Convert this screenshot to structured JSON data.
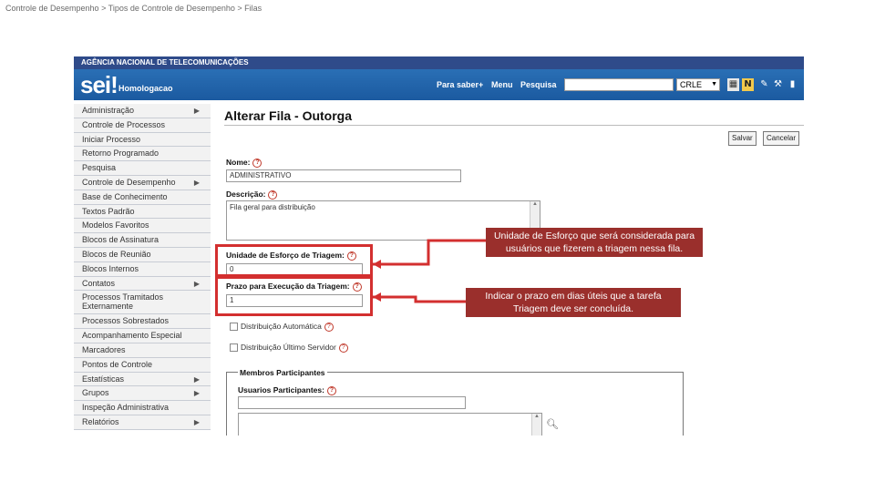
{
  "breadcrumb": "Controle de Desempenho > Tipos de Controle de Desempenho > Filas",
  "agency": "AGÊNCIA NACIONAL DE TELECOMUNICAÇÕES",
  "header": {
    "logo": "sei!",
    "environment": "Homologacao",
    "nav": [
      "Para saber+",
      "Menu",
      "Pesquisa"
    ],
    "search_value": "",
    "unit": "CRLE",
    "icons": [
      "notification-icon",
      "user-icon",
      "tools-icon",
      "exit-icon"
    ]
  },
  "sidebar": {
    "items": [
      {
        "label": "Administração",
        "submenu": true
      },
      {
        "label": "Controle de Processos",
        "submenu": false
      },
      {
        "label": "Iniciar Processo",
        "submenu": false
      },
      {
        "label": "Retorno Programado",
        "submenu": false
      },
      {
        "label": "Pesquisa",
        "submenu": false
      },
      {
        "label": "Controle de Desempenho",
        "submenu": true
      },
      {
        "label": "Base de Conhecimento",
        "submenu": false
      },
      {
        "label": "Textos Padrão",
        "submenu": false
      },
      {
        "label": "Modelos Favoritos",
        "submenu": false
      },
      {
        "label": "Blocos de Assinatura",
        "submenu": false
      },
      {
        "label": "Blocos de Reunião",
        "submenu": false
      },
      {
        "label": "Blocos Internos",
        "submenu": false
      },
      {
        "label": "Contatos",
        "submenu": true
      },
      {
        "label": "Processos Tramitados Externamente",
        "submenu": false,
        "tall": true
      },
      {
        "label": "Processos Sobrestados",
        "submenu": false
      },
      {
        "label": "Acompanhamento Especial",
        "submenu": false
      },
      {
        "label": "Marcadores",
        "submenu": false
      },
      {
        "label": "Pontos de Controle",
        "submenu": false
      },
      {
        "label": "Estatísticas",
        "submenu": true
      },
      {
        "label": "Grupos",
        "submenu": true
      },
      {
        "label": "Inspeção Administrativa",
        "submenu": false
      },
      {
        "label": "Relatórios",
        "submenu": true
      }
    ]
  },
  "form": {
    "title": "Alterar Fila - Outorga",
    "save_label": "Salvar",
    "cancel_label": "Cancelar",
    "nome_label": "Nome:",
    "nome_value": "ADMINISTRATIVO",
    "descricao_label": "Descrição:",
    "descricao_value": "Fila geral para distribuição",
    "esforco_label": "Unidade de Esforço de Triagem:",
    "esforco_value": "0",
    "prazo_label": "Prazo para Execução da Triagem:",
    "prazo_value": "1",
    "distrib_auto_label": "Distribuição Automática",
    "distrib_ultimo_label": "Distribuição Último Servidor",
    "membros_legend": "Membros Participantes",
    "usuarios_label": "Usuarios Participantes:",
    "usuarios_value": ""
  },
  "callouts": {
    "esforco": "Unidade de Esforço que será considerada para usuários que fizerem a triagem nessa fila.",
    "prazo": "Indicar o prazo em dias úteis que a tarefa Triagem deve ser concluída."
  },
  "colors": {
    "header": "#1b5aa0",
    "highlight": "#d32f2f",
    "callout": "#9a2f2c"
  }
}
